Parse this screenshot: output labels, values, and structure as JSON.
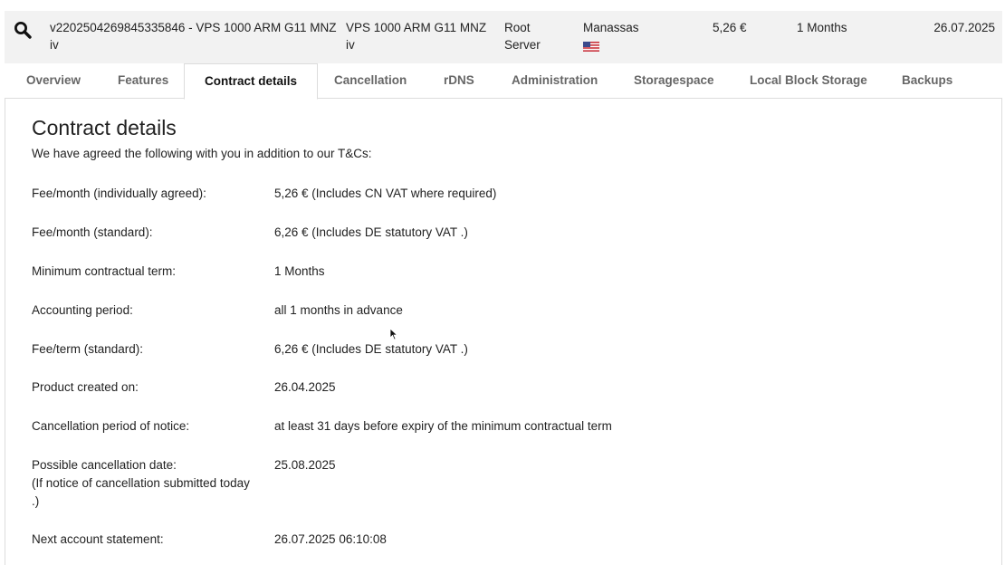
{
  "product": {
    "name": "v2202504269845335846 - VPS 1000 ARM G11 MNZ iv",
    "product_type": "VPS 1000 ARM G11 MNZ iv",
    "server_type": "Root Server",
    "location": "Manassas",
    "location_flag": "us-flag-icon",
    "price": "5,26 €",
    "term": "1 Months",
    "date": "26.07.2025"
  },
  "tabs": [
    {
      "label": "Overview",
      "active": false
    },
    {
      "label": "Features",
      "active": false
    },
    {
      "label": "Contract details",
      "active": true
    },
    {
      "label": "Cancellation",
      "active": false
    },
    {
      "label": "rDNS",
      "active": false
    },
    {
      "label": "Administration",
      "active": false
    },
    {
      "label": "Storagespace",
      "active": false
    },
    {
      "label": "Local Block Storage",
      "active": false
    },
    {
      "label": "Backups",
      "active": false
    }
  ],
  "contract": {
    "title": "Contract details",
    "intro": "We have agreed the following with you in addition to our T&Cs:",
    "rows": [
      {
        "label": "Fee/month (individually agreed):",
        "value": "5,26 € (Includes CN VAT where required)"
      },
      {
        "label": "Fee/month (standard):",
        "value": "6,26 € (Includes DE statutory VAT .)"
      },
      {
        "label": "Minimum contractual term:",
        "value": "1 Months"
      },
      {
        "label": "Accounting period:",
        "value": "all 1 months in advance"
      },
      {
        "label": "Fee/term (standard):",
        "value": "6,26 € (Includes DE statutory VAT .)"
      },
      {
        "label": "Product created on:",
        "value": "26.04.2025"
      },
      {
        "label": "Cancellation period of notice:",
        "value": "at least 31 days before expiry of the minimum contractual term"
      },
      {
        "label": "Possible cancellation date:",
        "label_note": "(If notice of cancellation submitted today .)",
        "value": "25.08.2025"
      },
      {
        "label": "Next account statement:",
        "value": "26.07.2025 06:10:08"
      }
    ]
  },
  "colors": {
    "header_bg": "#f2f2f2",
    "tab_text": "#666666",
    "active_tab_text": "#111111",
    "border": "#dcdcdc"
  }
}
